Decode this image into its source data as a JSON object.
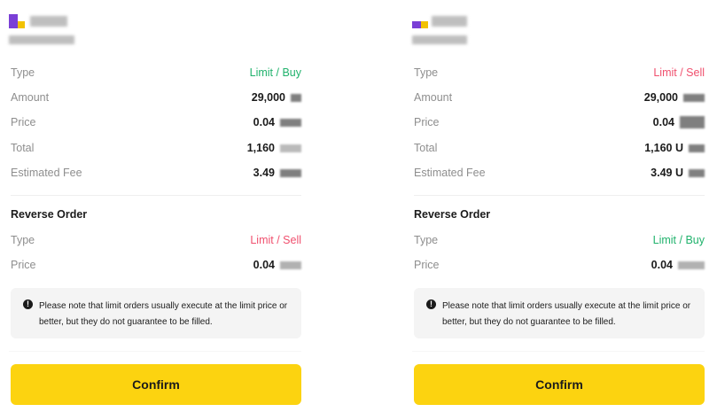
{
  "panels": [
    {
      "id": "buy",
      "rows": {
        "type": {
          "label": "Type",
          "value": "Limit / Buy",
          "tone": "green"
        },
        "amount": {
          "label": "Amount",
          "value": "29,000"
        },
        "price": {
          "label": "Price",
          "value": "0.04"
        },
        "total": {
          "label": "Total",
          "value": "1,160"
        },
        "fee": {
          "label": "Estimated Fee",
          "value": "3.49"
        }
      },
      "reverse": {
        "title": "Reverse Order",
        "type": {
          "label": "Type",
          "value": "Limit / Sell",
          "tone": "red"
        },
        "price": {
          "label": "Price",
          "value": "0.04"
        }
      },
      "note": "Please note that limit orders usually execute at the limit price or better, but they do not guarantee to be filled.",
      "confirm_label": "Confirm"
    },
    {
      "id": "sell",
      "rows": {
        "type": {
          "label": "Type",
          "value": "Limit / Sell",
          "tone": "red"
        },
        "amount": {
          "label": "Amount",
          "value": "29,000"
        },
        "price": {
          "label": "Price",
          "value": "0.04"
        },
        "total": {
          "label": "Total",
          "value": "1,160 U"
        },
        "fee": {
          "label": "Estimated Fee",
          "value": "3.49 U"
        }
      },
      "reverse": {
        "title": "Reverse Order",
        "type": {
          "label": "Type",
          "value": "Limit / Buy",
          "tone": "green"
        },
        "price": {
          "label": "Price",
          "value": "0.04"
        }
      },
      "note": "Please note that limit orders usually execute at the limit price or better, but they do not guarantee to be filled.",
      "confirm_label": "Confirm"
    }
  ],
  "icons": {
    "note": "info-icon",
    "logo": "brand-logo"
  },
  "colors": {
    "buy": "#20b26c",
    "sell": "#f0506e",
    "confirm_bg": "#fcd310",
    "note_bg": "#f4f4f4"
  }
}
